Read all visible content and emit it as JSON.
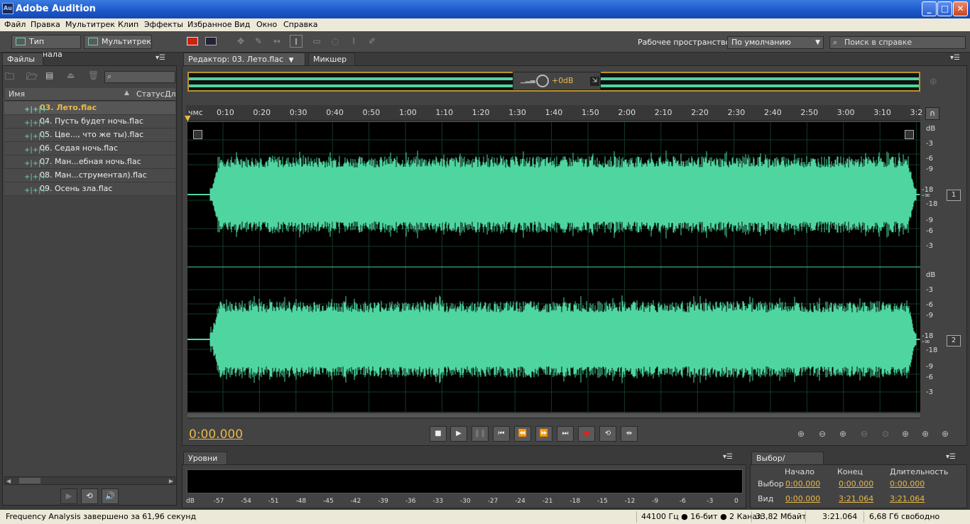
{
  "app": {
    "title": "Adobe Audition",
    "icon_text": "Au"
  },
  "menu": [
    "Файл",
    "Правка",
    "Мультитрек",
    "Клип",
    "Эффекты",
    "Избранное",
    "Вид",
    "Окно",
    "Справка"
  ],
  "toolbar": {
    "waveform_btn": "Тип сигнала",
    "multitrack_btn": "Мультитрек",
    "workspace_label": "Рабочее пространство:",
    "workspace_value": "По умолчанию",
    "search_placeholder": "Поиск в справке"
  },
  "files_panel": {
    "tab": "Файлы",
    "col_name": "Имя",
    "col_status": "Статус",
    "col_dur": "Дл",
    "files": [
      "03. Лето.flac",
      "04. Пусть будет ночь.flac",
      "05. Цве..., что же ты).flac",
      "06. Седая ночь.flac",
      "07. Ман...ебная ночь.flac",
      "08. Ман...струментал).flac",
      "09. Осень зла.flac"
    ]
  },
  "editor": {
    "tab": "Редактор: 03. Лето.flac",
    "mixer_tab": "Микшер",
    "gain": "+0",
    "gain_unit": "dB",
    "ruler_unit": "чмс",
    "ruler": [
      "0:10",
      "0:20",
      "0:30",
      "0:40",
      "0:50",
      "1:00",
      "1:10",
      "1:20",
      "1:30",
      "1:40",
      "1:50",
      "2:00",
      "2:10",
      "2:20",
      "2:30",
      "2:40",
      "2:50",
      "3:00",
      "3:10",
      "3:2"
    ],
    "db_scale": [
      "dB",
      "-3",
      "-6",
      "-9",
      "-18",
      "-∞",
      "-18",
      "-9",
      "-6",
      "-3"
    ],
    "channels": [
      "1",
      "2"
    ],
    "time": "0:00.000",
    "waveform_color": "#4fd6a0"
  },
  "levels": {
    "tab": "Уровни",
    "scale": [
      "dB",
      "-57",
      "-54",
      "-51",
      "-48",
      "-45",
      "-42",
      "-39",
      "-36",
      "-33",
      "-30",
      "-27",
      "-24",
      "-21",
      "-18",
      "-15",
      "-12",
      "-9",
      "-6",
      "-3",
      "0"
    ]
  },
  "selection": {
    "tab": "Выбор/Видимое",
    "headers": [
      "Начало",
      "Конец",
      "Длительность"
    ],
    "rows": [
      {
        "label": "Выбор",
        "start": "0:00.000",
        "end": "0:00.000",
        "dur": "0:00.000"
      },
      {
        "label": "Вид",
        "start": "0:00.000",
        "end": "3:21.064",
        "dur": "3:21.064"
      }
    ]
  },
  "status": {
    "message": "Frequency Analysis завершено за 61,96 секунд",
    "format": "44100 Гц ● 16-бит ● 2 Канал",
    "size": "33,82 Мбайт",
    "duration": "3:21.064",
    "free": "6,68 Гб свободно"
  }
}
